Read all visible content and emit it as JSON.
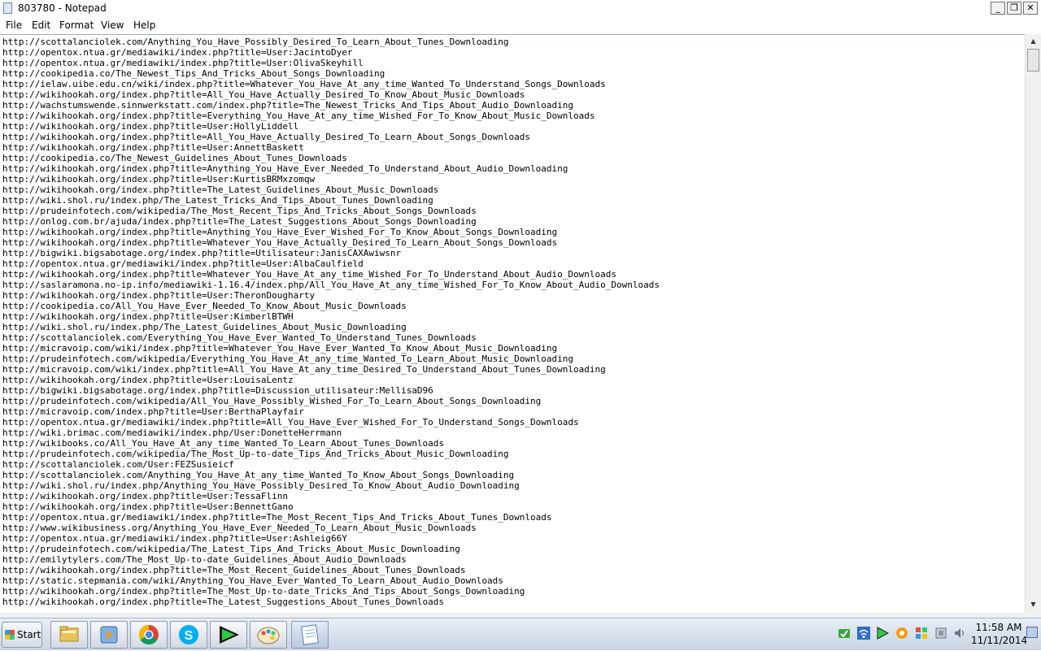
{
  "window": {
    "title": "803780 - Notepad",
    "minimize_label": "_",
    "maximize_label": "❐",
    "close_label": "✕"
  },
  "menu": [
    "File",
    "Edit",
    "Format",
    "View",
    "Help"
  ],
  "editor": {
    "lines": [
      "http://scottalanciolek.com/Anything_You_Have_Possibly_Desired_To_Learn_About_Tunes_Downloading",
      "http://opentox.ntua.gr/mediawiki/index.php?title=User:JacintoDyer",
      "http://opentox.ntua.gr/mediawiki/index.php?title=User:OlivaSkeyhill",
      "http://cookipedia.co/The_Newest_Tips_And_Tricks_About_Songs_Downloading",
      "http://ielaw.uibe.edu.cn/wiki/index.php?title=Whatever_You_Have_At_any_time_Wanted_To_Understand_Songs_Downloads",
      "http://wikihookah.org/index.php?title=All_You_Have_Actually_Desired_To_Know_About_Music_Downloads",
      "http://wachstumswende.sinnwerkstatt.com/index.php?title=The_Newest_Tricks_And_Tips_About_Audio_Downloading",
      "http://wikihookah.org/index.php?title=Everything_You_Have_At_any_time_Wished_For_To_Know_About_Music_Downloads",
      "http://wikihookah.org/index.php?title=User:HollyLiddell",
      "http://wikihookah.org/index.php?title=All_You_Have_Actually_Desired_To_Learn_About_Songs_Downloads",
      "http://wikihookah.org/index.php?title=User:AnnettBaskett",
      "http://cookipedia.co/The_Newest_Guidelines_About_Tunes_Downloads",
      "http://wikihookah.org/index.php?title=Anything_You_Have_Ever_Needed_To_Understand_About_Audio_Downloading",
      "http://wikihookah.org/index.php?title=User:KurtisBRMxzomqw",
      "http://wikihookah.org/index.php?title=The_Latest_Guidelines_About_Music_Downloads",
      "http://wiki.shol.ru/index.php/The_Latest_Tricks_And_Tips_About_Tunes_Downloading",
      "http://prudeinfotech.com/wikipedia/The_Most_Recent_Tips_And_Tricks_About_Songs_Downloads",
      "http://onlog.com.br/ajuda/index.php?title=The_Latest_Suggestions_About_Songs_Downloading",
      "http://wikihookah.org/index.php?title=Anything_You_Have_Ever_Wished_For_To_Know_About_Songs_Downloading",
      "http://wikihookah.org/index.php?title=Whatever_You_Have_Actually_Desired_To_Learn_About_Songs_Downloads",
      "http://bigwiki.bigsabotage.org/index.php?title=Utilisateur:JanisCAXAwiwsnr",
      "http://opentox.ntua.gr/mediawiki/index.php?title=User:AlbaCaulfield",
      "http://wikihookah.org/index.php?title=Whatever_You_Have_At_any_time_Wished_For_To_Understand_About_Audio_Downloads",
      "http://saslaramona.no-ip.info/mediawiki-1.16.4/index.php/All_You_Have_At_any_time_Wished_For_To_Know_About_Audio_Downloads",
      "http://wikihookah.org/index.php?title=User:TheronDougharty",
      "http://cookipedia.co/All_You_Have_Ever_Needed_To_Know_About_Music_Downloads",
      "http://wikihookah.org/index.php?title=User:KimberlBTWH",
      "http://wiki.shol.ru/index.php/The_Latest_Guidelines_About_Music_Downloading",
      "http://scottalanciolek.com/Everything_You_Have_Ever_Wanted_To_Understand_Tunes_Downloads",
      "http://micravoip.com/wiki/index.php?title=Whatever_You_Have_Ever_Wanted_To_Know_About_Music_Downloading",
      "http://prudeinfotech.com/wikipedia/Everything_You_Have_At_any_time_Wanted_To_Learn_About_Music_Downloading",
      "http://micravoip.com/wiki/index.php?title=All_You_Have_At_any_time_Desired_To_Understand_About_Tunes_Downloading",
      "http://wikihookah.org/index.php?title=User:LouisaLentz",
      "http://bigwiki.bigsabotage.org/index.php?title=Discussion_utilisateur:MellisaD96",
      "http://prudeinfotech.com/wikipedia/All_You_Have_Possibly_Wished_For_To_Learn_About_Songs_Downloading",
      "http://micravoip.com/index.php?title=User:BerthaPlayfair",
      "http://opentox.ntua.gr/mediawiki/index.php?title=All_You_Have_Ever_Wished_For_To_Understand_Songs_Downloads",
      "http://wiki.brimac.com/mediawiki/index.php/User:DonetteHerrmann",
      "http://wikibooks.co/All_You_Have_At_any_time_Wanted_To_Learn_About_Tunes_Downloads",
      "http://prudeinfotech.com/wikipedia/The_Most_Up-to-date_Tips_And_Tricks_About_Music_Downloading",
      "http://scottalanciolek.com/User:FEZSusieicf",
      "http://scottalanciolek.com/Anything_You_Have_At_any_time_Wanted_To_Know_About_Songs_Downloading",
      "http://wiki.shol.ru/index.php/Anything_You_Have_Possibly_Desired_To_Know_About_Audio_Downloading",
      "http://wikihookah.org/index.php?title=User:TessaFlinn",
      "http://wikihookah.org/index.php?title=User:BennettGano",
      "http://opentox.ntua.gr/mediawiki/index.php?title=The_Most_Recent_Tips_And_Tricks_About_Tunes_Downloads",
      "http://www.wikibusiness.org/Anything_You_Have_Ever_Needed_To_Learn_About_Music_Downloads",
      "http://opentox.ntua.gr/mediawiki/index.php?title=User:Ashleig66Y",
      "http://prudeinfotech.com/wikipedia/The_Latest_Tips_And_Tricks_About_Music_Downloading",
      "http://emilytylers.com/The_Most_Up-to-date_Guidelines_About_Audio_Downloads",
      "http://wikihookah.org/index.php?title=The_Most_Recent_Guidelines_About_Tunes_Downloads",
      "http://static.stepmania.com/wiki/Anything_You_Have_Ever_Wanted_To_Learn_About_Audio_Downloads",
      "http://wikihookah.org/index.php?title=The_Most_Up-to-date_Tricks_And_Tips_About_Songs_Downloading",
      "http://wikihookah.org/index.php?title=The_Latest_Suggestions_About_Tunes_Downloads"
    ]
  },
  "taskbar": {
    "start_label": "Start",
    "clock_time": "11:58 AM",
    "clock_date": "11/11/2014"
  },
  "colors": {
    "taskbar_top": "#e9eef6",
    "taskbar_bottom": "#c9d4e3",
    "chrome_red": "#db4437",
    "chrome_green": "#0f9d58",
    "chrome_yellow": "#f4b400",
    "chrome_blue": "#4285f4",
    "skype_blue": "#00aff0"
  },
  "icons": {
    "app": "notepad-icon",
    "scroll_up": "arrow-up-icon",
    "scroll_down": "arrow-down-icon",
    "taskbar_apps": [
      "file-explorer-icon",
      "media-player-icon",
      "chrome-icon",
      "skype-icon",
      "green-play-icon",
      "paint-icon",
      "notepad-icon"
    ],
    "tray": [
      "network-icon",
      "wifi-icon",
      "media-play-icon",
      "orange-circle-icon",
      "colorful-app-icon",
      "flag-icon",
      "volume-icon"
    ]
  }
}
